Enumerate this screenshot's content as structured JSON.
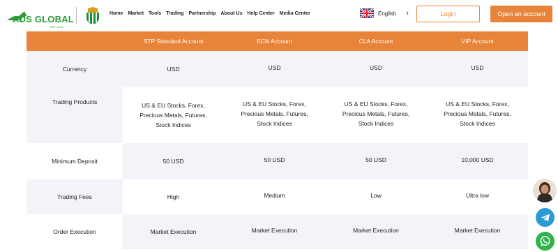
{
  "brand": {
    "name": "AUS GLOBAL",
    "est": "EST. 2013",
    "accent": "#e8843a",
    "brand_green": "#2e9b3a"
  },
  "nav": {
    "items": [
      "Home",
      "Market",
      "Tools",
      "Trading",
      "Partnership",
      "About Us",
      "Help Center",
      "Media Center"
    ]
  },
  "language": {
    "label": "English",
    "flag_icon": "uk-flag-icon"
  },
  "header_buttons": {
    "login": "Login",
    "open_account": "Open an account"
  },
  "table": {
    "columns": [
      "",
      "STP Standard Account",
      "ECN Account",
      "CLA Account",
      "VIP Account"
    ],
    "rows": [
      {
        "label": "Currency",
        "values": [
          "USD",
          "USD",
          "USD",
          "USD"
        ]
      },
      {
        "label": "Trading Products",
        "values": [
          "US & EU Stocks, Forex, Precious Metals, Futures, Stock Indices",
          "US & EU Stocks, Forex, Precious Metals, Futures, Stock Indices",
          "US & EU Stocks, Forex, Precious Metals, Futures, Stock Indices",
          "US & EU Stocks, Forex, Precious Metals, Futures, Stock Indices"
        ]
      },
      {
        "label": "Minimum Deposit",
        "values": [
          "50 USD",
          "50 USD",
          "50 USD",
          "10,000 USD"
        ]
      },
      {
        "label": "Trading Fees",
        "values": [
          "High",
          "Medium",
          "Low",
          "Ultra low"
        ]
      },
      {
        "label": "Order Execution",
        "values": [
          "Market Execution",
          "Market Execution",
          "Market Execution",
          "Market Execution"
        ]
      }
    ]
  },
  "floating": {
    "avatar_icon": "support-agent-avatar",
    "telegram_icon": "telegram-icon",
    "whatsapp_icon": "whatsapp-icon"
  }
}
